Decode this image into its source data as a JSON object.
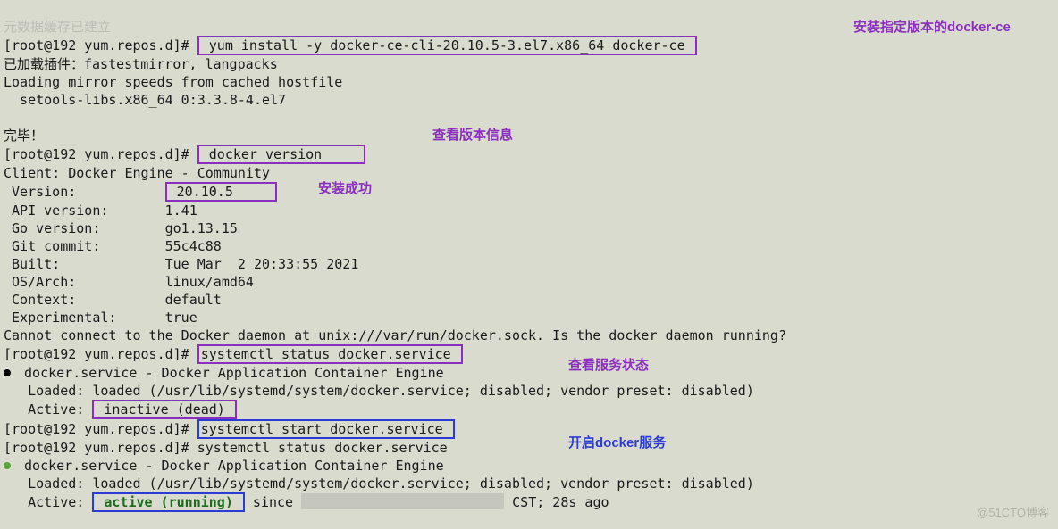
{
  "top_truncated": "元数据缓存已建立",
  "prompt": "[root@192 yum.repos.d]# ",
  "cmd_yum": "yum install -y docker-ce-cli-20.10.5-3.el7.x86_64 docker-ce",
  "loaded_plugins": "已加载插件：fastestmirror, langpacks",
  "loading_mirrors": "Loading mirror speeds from cached hostfile",
  "setools_line": "  setools-libs.x86_64 0:3.3.8-4.el7",
  "done": "完毕！",
  "cmd_version": "docker version",
  "client_header": "Client: Docker Engine - Community",
  "ver_label_pad": " Version:           ",
  "ver_value": "20.10.5",
  "api_line": " API version:       1.41",
  "go_line": " Go version:        go1.13.15",
  "git_line": " Git commit:        55c4c88",
  "built_line": " Built:             Tue Mar  2 20:33:55 2021",
  "os_line": " OS/Arch:           linux/amd64",
  "ctx_line": " Context:           default",
  "exp_line": " Experimental:      true",
  "cannot_connect": "Cannot connect to the Docker daemon at unix:///var/run/docker.sock. Is the docker daemon running?",
  "cmd_status": "systemctl status docker.service",
  "svc_desc": " docker.service - Docker Application Container Engine",
  "loaded_line": "   Loaded: loaded (/usr/lib/systemd/system/docker.service; disabled; vendor preset: disabled)",
  "active_pref": "   Active: ",
  "inactive_dead": "inactive (dead)",
  "cmd_start": "systemctl start docker.service",
  "active_running": "active (running)",
  "since_pref": " since ",
  "since_suffix": " CST; 28s ago",
  "annot_install": "安装指定版本的docker-ce",
  "annot_version": "查看版本信息",
  "annot_success": "安装成功",
  "annot_status": "查看服务状态",
  "annot_start": "开启docker服务",
  "watermark": "@51CTO博客"
}
